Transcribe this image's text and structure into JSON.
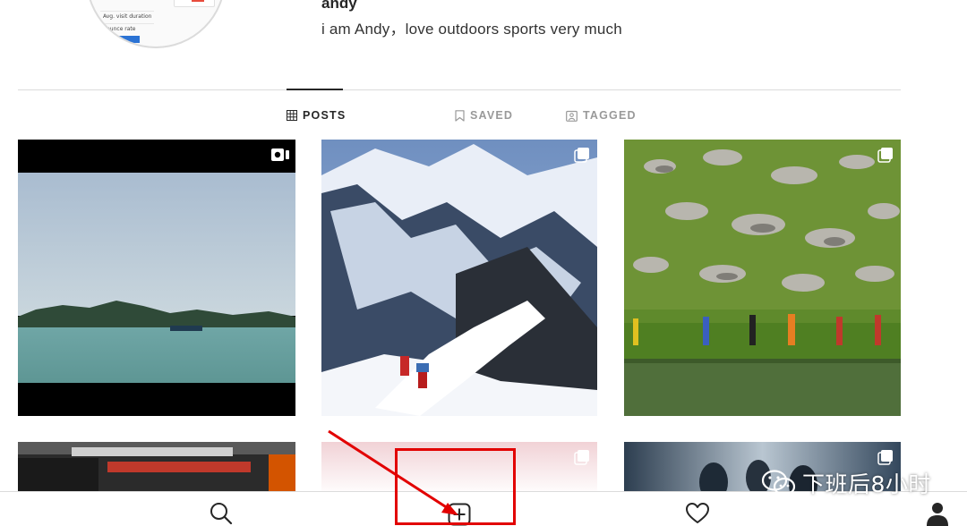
{
  "profile": {
    "username": "andy",
    "bio": "i am Andy，love outdoors sports very much",
    "avatar_texts": [
      "Avg. visit duration",
      "Bounce rate"
    ]
  },
  "tabs": [
    {
      "label": "POSTS",
      "icon": "grid-icon",
      "active": true
    },
    {
      "label": "SAVED",
      "icon": "bookmark-icon",
      "active": false
    },
    {
      "label": "TAGGED",
      "icon": "tagged-icon",
      "active": false
    }
  ],
  "posts": [
    {
      "subject": "lake",
      "badge": "video-icon"
    },
    {
      "subject": "snow-mountain-climbers",
      "badge": "multiple-photos-icon"
    },
    {
      "subject": "hikers-green-meadow",
      "badge": "multiple-photos-icon"
    },
    {
      "subject": "red-black-objects",
      "badge": "none"
    },
    {
      "subject": "pink-gradient",
      "badge": "multiple-photos-icon"
    },
    {
      "subject": "movie-characters",
      "badge": "multiple-photos-icon"
    }
  ],
  "bottom_nav": [
    "search-icon",
    "new-post-icon",
    "activity-heart-icon",
    "profile-icon"
  ],
  "colors": {
    "annotation": "#e20000",
    "divider": "#dbdbdb",
    "text": "#262626",
    "muted": "#999999"
  },
  "watermark": {
    "text": "下班后8小时",
    "icon": "wechat-icon"
  }
}
